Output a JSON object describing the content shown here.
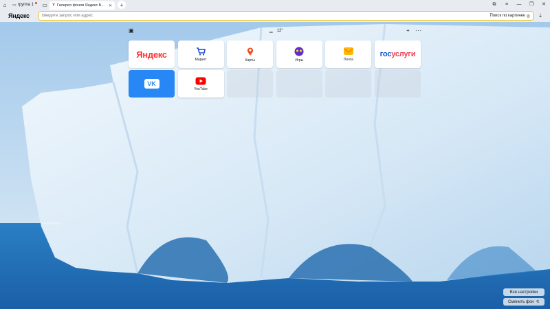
{
  "tabbar": {
    "group_label": "группа 1",
    "active_tab_title": "Галерея фонов Яндекс Б...",
    "active_tab_favicon": "Y"
  },
  "addressbar": {
    "logo": "Яндекс",
    "placeholder": "Введите запрос или адрес",
    "image_search_label": "Поиск по картинке"
  },
  "ntp": {
    "weather": "12°"
  },
  "tiles": [
    {
      "id": "yandex",
      "logo": "Яндекс",
      "caption": ""
    },
    {
      "id": "market",
      "caption": "Маркет"
    },
    {
      "id": "maps",
      "caption": "Карты"
    },
    {
      "id": "games",
      "caption": "Игры"
    },
    {
      "id": "mail",
      "caption": "Почта"
    },
    {
      "id": "gosuslugi",
      "logo_a": "гос",
      "logo_b": "услуги"
    },
    {
      "id": "vk",
      "logo": "VK"
    },
    {
      "id": "youtube",
      "caption": "YouTube"
    }
  ],
  "bottom": {
    "settings_label": "Все настройки",
    "change_bg_label": "Сменить фон"
  },
  "colors": {
    "accent": "#f5c518",
    "vk_blue": "#2787f5",
    "yandex_red": "#f33"
  }
}
